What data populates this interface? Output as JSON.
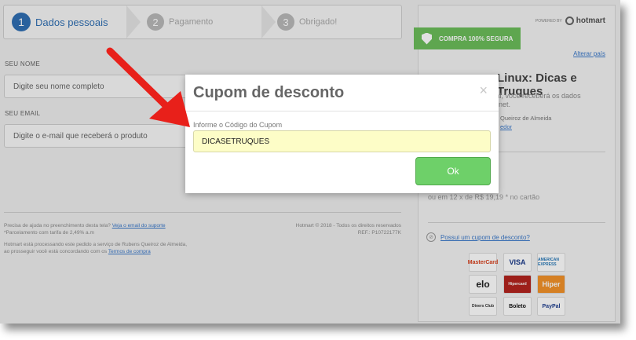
{
  "stepper": {
    "steps": [
      {
        "num": "1",
        "label": "Dados pessoais"
      },
      {
        "num": "2",
        "label": "Pagamento"
      },
      {
        "num": "3",
        "label": "Obrigado!"
      }
    ]
  },
  "form": {
    "name_label": "SEU NOME",
    "name_placeholder": "Digite seu nome completo",
    "email_label": "SEU EMAIL",
    "email_placeholder": "Digite o e-mail que receberá o produto"
  },
  "footer": {
    "help_text": "Precisa de ajuda no preenchimento desta tela?",
    "help_link": "Veja o email do suporte",
    "installment_note": "*Parcelamento com tarifa de 2,49% a.m",
    "processing_line1": "Hotmart está processando este pedido a serviço de Rubens Queiroz de Almeida,",
    "processing_line2": "ao prosseguir você está concordando com os",
    "terms_link": "Termos de compra",
    "copyright": "Hotmart © 2018 - Todos os direitos reservados",
    "ref": "REF.: P10722177K"
  },
  "panel": {
    "powered_by": "POWERED BY",
    "brand": "hotmart",
    "secure_badge": "COMPRA 100% SEGURA",
    "change_country": "Alterar país",
    "product_title": "Linux: Dicas e Truques",
    "product_sub1": "ital, você receberá os dados",
    "product_sub2": "ernet.",
    "author": "Queiroz de Almeida",
    "author_link": "edor",
    "price_line": "ou em 12 x de R$ 19,19 * no cartão",
    "coupon_link": "Possui um cupom de desconto?",
    "payment_methods": [
      "MasterCard",
      "VISA",
      "AMERICAN EXPRESS",
      "elo",
      "Hipercard",
      "Hiper",
      "Diners Club",
      "Boleto",
      "PayPal"
    ]
  },
  "modal": {
    "title": "Cupom de desconto",
    "close": "×",
    "field_label": "Informe o Código do Cupom",
    "field_value": "DICASETRUQUES",
    "ok_label": "Ok"
  },
  "colors": {
    "accent_blue": "#2f6fb3",
    "secure_green": "#6bbd5b",
    "ok_green": "#6ed069",
    "arrow_red": "#e8201a",
    "coupon_input_bg": "#fdfdc7"
  }
}
